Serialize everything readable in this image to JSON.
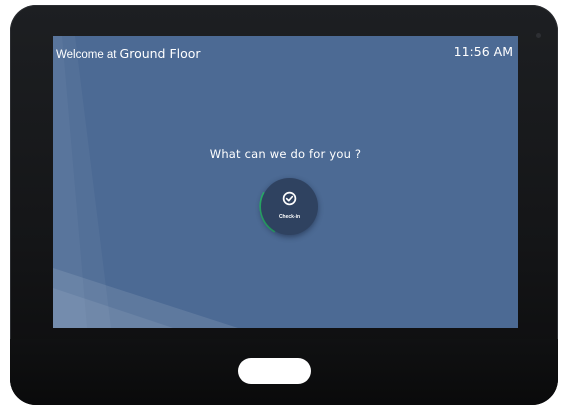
{
  "header": {
    "welcome_prefix": "Welcome at",
    "location": "Ground Floor",
    "time": "11:56 AM"
  },
  "main": {
    "prompt": "What can we do for you ?",
    "actions": [
      {
        "label": "Check-in",
        "icon": "check-circle-icon",
        "accent": "#2dbd6e"
      }
    ]
  },
  "colors": {
    "screen_background": "#4c6a94",
    "button_background": "#2f4260",
    "bezel": "#17181a"
  }
}
